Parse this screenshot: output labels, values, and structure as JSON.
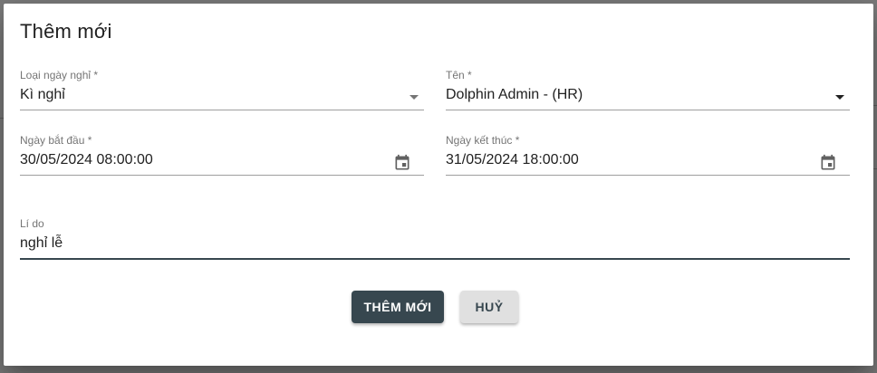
{
  "dialog": {
    "title": "Thêm mới"
  },
  "form": {
    "leave_type": {
      "label": "Loại ngày nghỉ *",
      "value": "Kì nghỉ"
    },
    "name": {
      "label": "Tên *",
      "value": "Dolphin Admin - (HR)"
    },
    "start_date": {
      "label": "Ngày bắt đầu *",
      "value": "30/05/2024 08:00:00"
    },
    "end_date": {
      "label": "Ngày kết thúc *",
      "value": "31/05/2024 18:00:00"
    },
    "reason": {
      "label": "Lí do",
      "value": "nghỉ lễ"
    }
  },
  "actions": {
    "submit_label": "THÊM MỚI",
    "cancel_label": "HUỶ"
  },
  "colors": {
    "primary": "#37474f",
    "secondary_bg": "#e0e0e0"
  }
}
